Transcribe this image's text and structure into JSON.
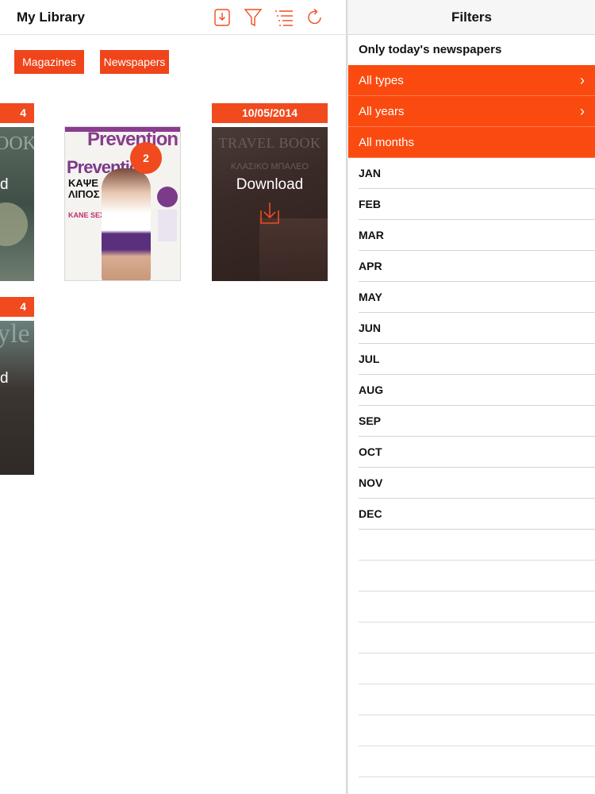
{
  "library": {
    "title": "My Library",
    "categories": [
      "Magazines",
      "Newspapers"
    ],
    "date_labels": [
      "4",
      "10/05/2014",
      "4"
    ],
    "badge_count": "2",
    "cover_left_top": {
      "overlay_text": "d",
      "masthead": "OOK"
    },
    "cover_prevention": {
      "masthead": "Prevention",
      "headline": "ΚΑΨΕ ΛΙΠΟΣ",
      "sub": "ΚΑΝΕ SEX"
    },
    "cover_travel": {
      "masthead": "TRAVEL BOOK",
      "subtitle": "ΚΛΑΣΙΚΟ ΜΠΑΛΕΟ",
      "download": "Download"
    },
    "cover_left_bottom": {
      "overlay_text": "d",
      "masthead": "yle"
    }
  },
  "filters": {
    "title": "Filters",
    "only_today": "Only today's newspapers",
    "types": "All types",
    "years": "All years",
    "months": "All months",
    "month_list": [
      "JAN",
      "FEB",
      "MAR",
      "APR",
      "MAY",
      "JUN",
      "JUL",
      "AUG",
      "SEP",
      "OCT",
      "NOV",
      "DEC"
    ]
  },
  "colors": {
    "accent": "#fb4a0f",
    "accent_dark": "#f04a1e"
  }
}
